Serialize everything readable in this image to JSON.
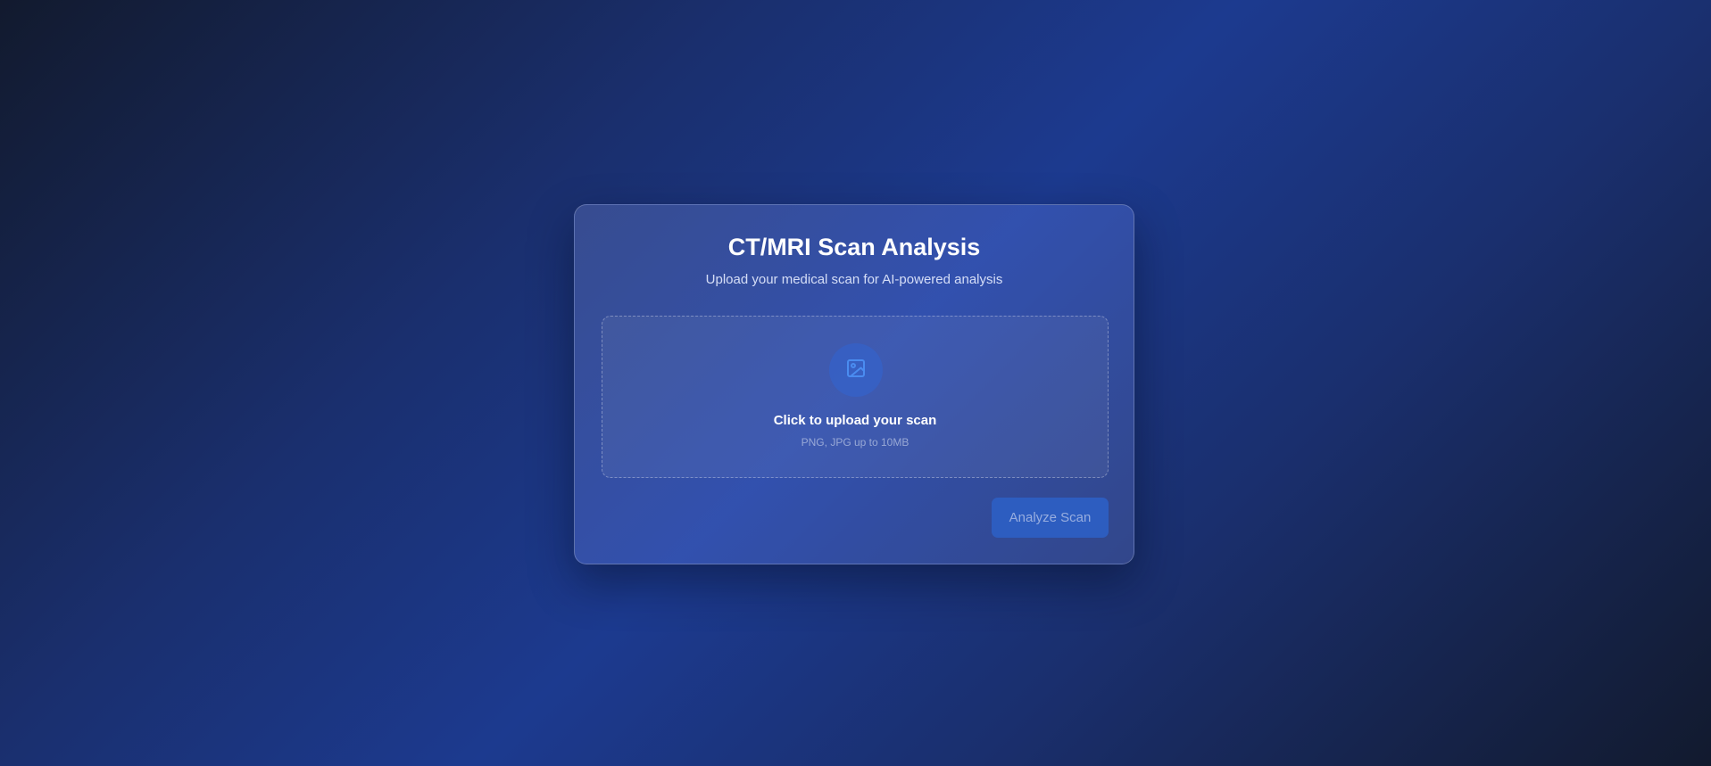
{
  "card": {
    "title": "CT/MRI Scan Analysis",
    "subtitle": "Upload your medical scan for AI-powered analysis"
  },
  "upload": {
    "icon": "image-icon",
    "label": "Click to upload your scan",
    "hint": "PNG, JPG up to 10MB"
  },
  "actions": {
    "analyze_label": "Analyze Scan",
    "analyze_disabled": true
  },
  "colors": {
    "accent": "#2d5fc4",
    "icon": "#4a8cf0"
  }
}
